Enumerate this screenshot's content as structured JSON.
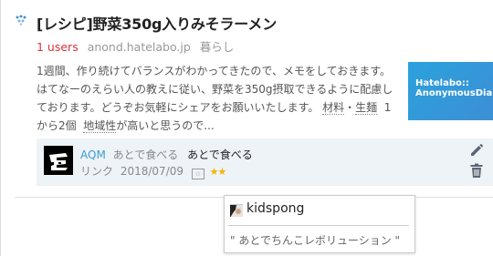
{
  "entry": {
    "title": "[レシピ]野菜350g入りみそラーメン",
    "users": "1 users",
    "domain": "anond.hatelabo.jp",
    "category": "暮らし",
    "summary_lines": [
      "1週間、作り続けてバランスがわかってきたので、メモをしておきます。",
      "はてなーのえらい人の教えに従い、野菜を350g摂取できるように配慮し",
      "ております。どうぞお気軽にシェアをお願いいたします。"
    ],
    "summary_kw1": "材料",
    "summary_sep": "・",
    "summary_kw2": "生麺",
    "summary_after": "1",
    "summary_last_pre": "から2個",
    "summary_kw3": "地域性",
    "summary_last_post": "が高いと思うので...",
    "thumbnail_line1": "Hatelabo::",
    "thumbnail_line2": "AnonymousDiary"
  },
  "comment": {
    "user": "AQM",
    "tag": "あとで食べる",
    "text": "あとで食べる",
    "link_label": "リンク",
    "date": "2018/07/09",
    "star_icon_text": "☆",
    "stars": "★★"
  },
  "tooltip": {
    "username": "kidspong",
    "text": "\" あとでちんこレボリューション \""
  },
  "colors": {
    "users": "#d9333f",
    "comment_user": "#3e9bd0",
    "comment_bg": "#eef3f8",
    "thumbnail": "#2aa2dd",
    "star": "#f5b400"
  }
}
